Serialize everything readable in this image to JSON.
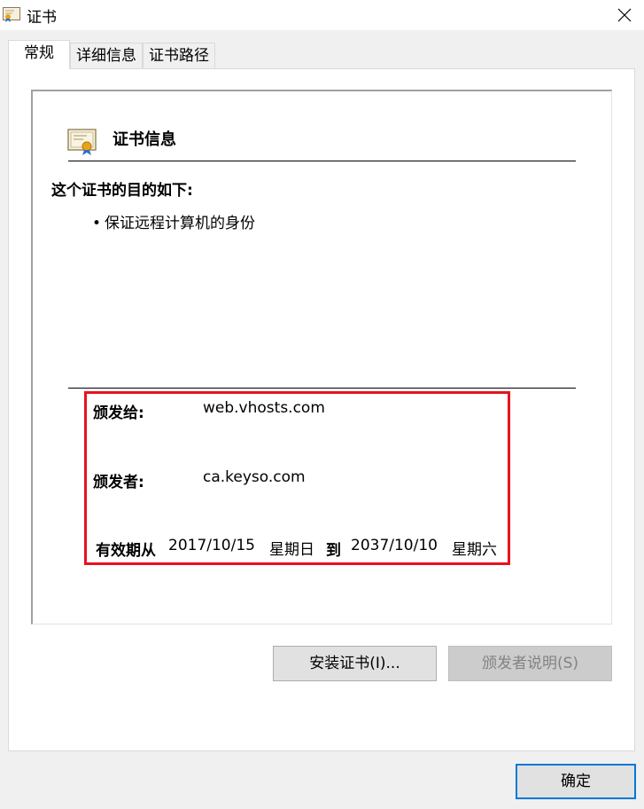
{
  "window": {
    "title": "证书",
    "close_symbol": "×"
  },
  "tabs": [
    {
      "label": "常规",
      "active": true
    },
    {
      "label": "详细信息",
      "active": false
    },
    {
      "label": "证书路径",
      "active": false
    }
  ],
  "cert_info": {
    "title": "证书信息",
    "purpose_heading": "这个证书的目的如下:",
    "purposes": [
      "保证远程计算机的身份"
    ],
    "issued_to_label": "颁发给:",
    "issued_to": "web.vhosts.com",
    "issued_by_label": "颁发者:",
    "issued_by": "ca.keyso.com",
    "validity_label": "有效期从",
    "valid_from": "2017/10/15",
    "valid_from_day": "星期日",
    "to_label": "到",
    "valid_to": "2037/10/10",
    "valid_to_day": "星期六"
  },
  "buttons": {
    "install": "安装证书(I)...",
    "issuer_statement": "颁发者说明(S)",
    "ok": "确定"
  },
  "colors": {
    "highlight_border": "#e8121f",
    "focus_border": "#0078d7",
    "disabled_text": "#838383"
  },
  "icons": {
    "title": "certificate-icon",
    "close": "close-icon",
    "cert": "certificate-icon"
  }
}
